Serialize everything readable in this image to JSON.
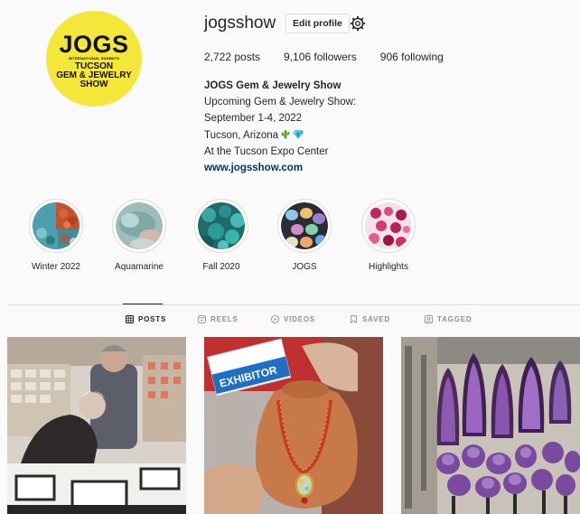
{
  "profile": {
    "logo": {
      "top": "JOGS",
      "sub": "INTERNATIONAL EXHIBITS",
      "line1": "TUCSON",
      "line2": "GEM & JEWELRY",
      "line3": "SHOW"
    },
    "username": "jogsshow",
    "edit_label": "Edit profile",
    "posts": "2,722 posts",
    "followers": "9,106 followers",
    "following": "906 following",
    "bio_name": "JOGS Gem & Jewelry Show",
    "bio_line1": "Upcoming Gem & Jewelry Show:",
    "bio_line2": "September 1-4, 2022",
    "bio_line3": "Tucson, Arizona",
    "bio_line4": "At the Tucson Expo Center",
    "website": "www.jogsshow.com"
  },
  "highlights": [
    {
      "label": "Winter 2022"
    },
    {
      "label": "Aquamarine"
    },
    {
      "label": "Fall 2020"
    },
    {
      "label": "JOGS"
    },
    {
      "label": "Highlights"
    }
  ],
  "tabs": {
    "posts": "POSTS",
    "reels": "REELS",
    "videos": "VIDEOS",
    "saved": "SAVED",
    "tagged": "TAGGED"
  },
  "posts": {
    "badge_text": "EXHIBITOR"
  },
  "colors": {
    "link": "#00376b",
    "logo_yellow": "#f5e63a",
    "border": "#dbdbdb"
  }
}
